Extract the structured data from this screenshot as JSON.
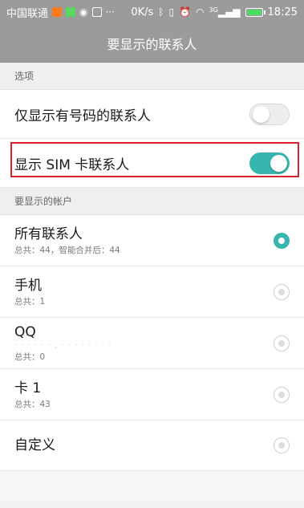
{
  "status_bar": {
    "carrier": "中国联通",
    "speed": "0K/s",
    "network": "3G",
    "time": "18:25",
    "battery_level": 1.0,
    "icons": [
      "notification-app-icon",
      "sim-icon",
      "wechat-icon",
      "image-icon",
      "more-dots-icon",
      "bluetooth-icon",
      "vibrate-icon",
      "alarm-icon",
      "wifi-icon",
      "signal-icon",
      "battery-icon"
    ]
  },
  "header": {
    "title": "要显示的联系人"
  },
  "options_section": {
    "title": "选项",
    "items": [
      {
        "label": "仅显示有号码的联系人",
        "enabled": false
      },
      {
        "label": "显示 SIM 卡联系人",
        "enabled": true
      }
    ]
  },
  "accounts_section": {
    "title": "要显示的帐户",
    "items": [
      {
        "name": "所有联系人",
        "subtitle": "总共：44，智能合并后：44",
        "selected": true
      },
      {
        "name": "手机",
        "subtitle": "总共：1",
        "selected": false
      },
      {
        "name": "QQ",
        "subtitle": "总共：0",
        "selected": false
      },
      {
        "name": "卡 1",
        "subtitle": "总共：43",
        "selected": false
      },
      {
        "name": "自定义",
        "selected": false
      }
    ]
  },
  "colors": {
    "accent": "#37b6ad",
    "header_bg": "#9b9b9b",
    "highlight_box": "#d9222a"
  }
}
